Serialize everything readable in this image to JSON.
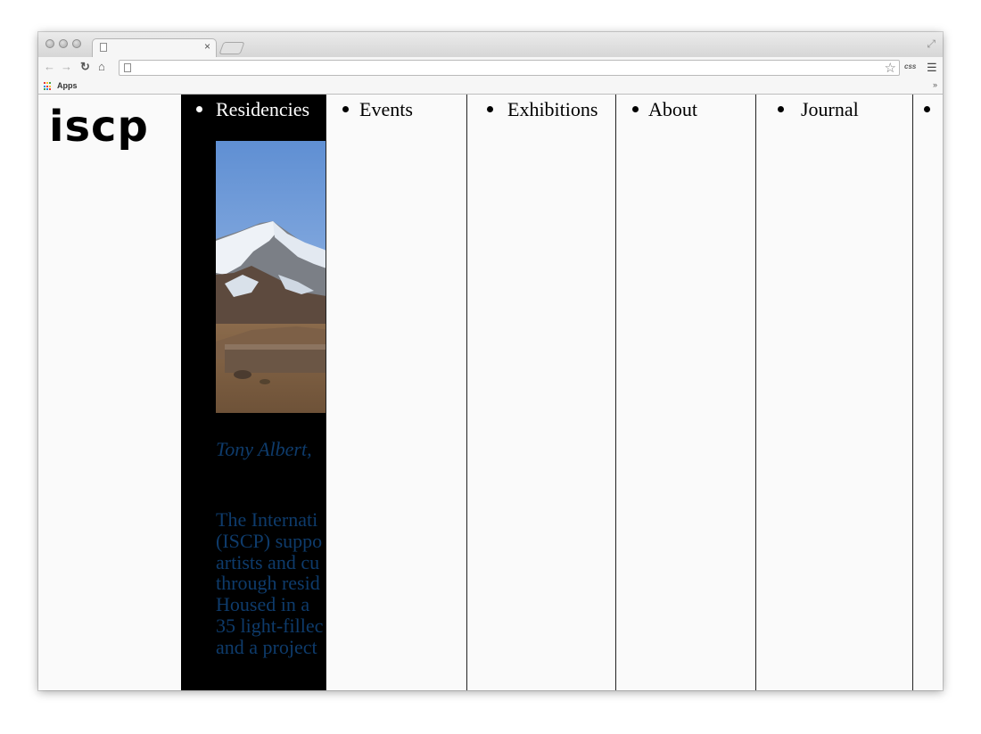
{
  "browser": {
    "tab_close_glyph": "×",
    "omnibox_value": "",
    "extension_label": "css",
    "bookmarks": {
      "apps_label": "Apps",
      "more_glyph": "»"
    },
    "icons": {
      "back": "arrow-left-icon",
      "forward": "arrow-right-icon",
      "reload": "reload-icon",
      "home": "home-icon",
      "star": "star-icon",
      "menu": "hamburger-menu-icon"
    }
  },
  "site": {
    "logo": "iscp",
    "nav": [
      {
        "label": "Residencies",
        "active": true
      },
      {
        "label": "Events"
      },
      {
        "label": "Exhibitions"
      },
      {
        "label": "About"
      },
      {
        "label": "Journal"
      },
      {
        "label": ""
      }
    ],
    "residencies": {
      "image_alt": "mountain landscape photo",
      "caption": "Tony Albert,",
      "intro_lines": [
        "The Internati",
        "(ISCP) suppo",
        "artists and cu",
        "through resid",
        "Housed in a",
        "35 light-fillec",
        "and a project"
      ]
    },
    "colors": {
      "active_column_bg": "#000000",
      "text_blue": "#0e3b6b",
      "page_bg": "#fafafa"
    }
  }
}
